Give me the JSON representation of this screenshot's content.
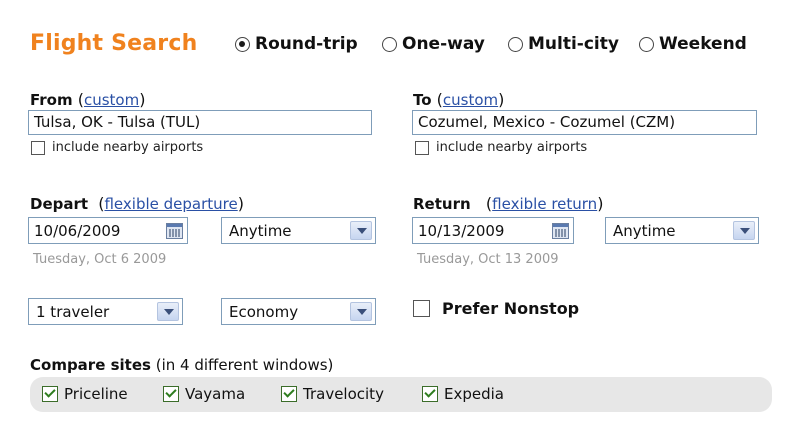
{
  "header": {
    "title": "Flight Search",
    "trip_types": [
      {
        "label": "Round-trip",
        "selected": true
      },
      {
        "label": "One-way",
        "selected": false
      },
      {
        "label": "Multi-city",
        "selected": false
      },
      {
        "label": "Weekend",
        "selected": false
      }
    ]
  },
  "from": {
    "label": "From",
    "custom_link": "custom",
    "value": "Tulsa, OK - Tulsa (TUL)",
    "nearby_label": "include nearby airports",
    "nearby_checked": false
  },
  "to": {
    "label": "To",
    "custom_link": "custom",
    "value": "Cozumel, Mexico - Cozumel (CZM)",
    "nearby_label": "include nearby airports",
    "nearby_checked": false
  },
  "depart": {
    "label": "Depart",
    "flex_link": "flexible departure",
    "date": "10/06/2009",
    "time": "Anytime",
    "subtext": "Tuesday, Oct 6 2009"
  },
  "return": {
    "label": "Return",
    "flex_link": "flexible return",
    "date": "10/13/2009",
    "time": "Anytime",
    "subtext": "Tuesday, Oct 13 2009"
  },
  "options": {
    "travelers": "1 traveler",
    "cabin": "Economy",
    "nonstop_label": "Prefer Nonstop",
    "nonstop_checked": false
  },
  "compare": {
    "label": "Compare sites",
    "sublabel": "(in 4 different windows)",
    "sites": [
      {
        "label": "Priceline",
        "checked": true
      },
      {
        "label": "Vayama",
        "checked": true
      },
      {
        "label": "Travelocity",
        "checked": true
      },
      {
        "label": "Expedia",
        "checked": true
      }
    ]
  },
  "colors": {
    "title": "#f0821e",
    "link": "#2a50a5",
    "compare_bg": "#e7e7e7"
  }
}
